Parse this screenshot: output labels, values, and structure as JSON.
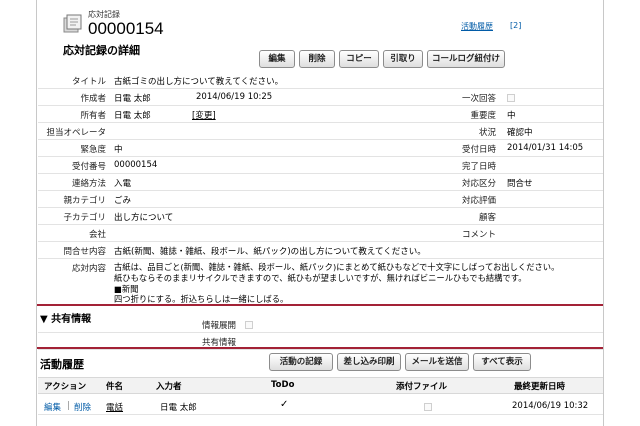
{
  "header": {
    "record_label": "応対記録",
    "record_number": "00000154",
    "detail_title": "応対記録の詳細",
    "history_link": "活動履歴",
    "history_count": "[2]"
  },
  "toolbar": {
    "edit": "編集",
    "delete": "削除",
    "copy": "コピー",
    "withdraw": "引取り",
    "link_call_log": "コールログ紐付け"
  },
  "fields": {
    "title_label": "タイトル",
    "title_value": "古紙ゴミの出し方について教えてください。",
    "creator_label": "作成者",
    "creator_value": "日電 太郎",
    "creator_date": "2014/06/19 10:25",
    "first_response_label": "一次回答",
    "owner_label": "所有者",
    "owner_value": "日電 太郎",
    "owner_change": "[変更]",
    "importance_label": "重要度",
    "importance_value": "中",
    "operator_label": "担当オペレータ",
    "status_label": "状況",
    "status_value": "確認中",
    "urgency_label": "緊急度",
    "urgency_value": "中",
    "received_label": "受付日時",
    "received_value": "2014/01/31 14:05",
    "receipt_no_label": "受付番号",
    "receipt_no_value": "00000154",
    "completed_label": "完了日時",
    "contact_method_label": "連絡方法",
    "contact_method_value": "入電",
    "response_type_label": "対応区分",
    "response_type_value": "問合せ",
    "parent_category_label": "親カテゴリ",
    "parent_category_value": "ごみ",
    "response_eval_label": "対応評価",
    "child_category_label": "子カテゴリ",
    "child_category_value": "出し方について",
    "customer_label": "顧客",
    "company_label": "会社",
    "comment_label": "コメント",
    "inquiry_label": "問合せ内容",
    "inquiry_value": "古紙(新聞、雑誌・雑紙、段ボール、紙パック)の出し方について教えてください。",
    "response_label": "応対内容",
    "response_lines": [
      "古紙は、品目ごと(新聞、雑誌・雑紙、段ボール、紙パック)にまとめて紙ひもなどで十文字にしばってお出しください。",
      "紙ひもならそのままリサイクルできますので、紙ひもが望ましいですが、無ければビニールひもでも結構です。",
      "■新聞",
      "四つ折りにする。折込ちらしは一緒にしばる。"
    ]
  },
  "shared": {
    "title": "▼ 共有情報",
    "info_expand_label": "情報展開",
    "shared_info_label": "共有情報"
  },
  "activity": {
    "title": "活動履歴",
    "buttons": {
      "record": "活動の記録",
      "mail_merge": "差し込み印刷",
      "send_mail": "メールを送信",
      "show_all": "すべて表示"
    },
    "columns": {
      "action": "アクション",
      "subject": "件名",
      "entered_by": "入力者",
      "todo": "ToDo",
      "attachment": "添付ファイル",
      "last_updated": "最終更新日時"
    },
    "row": {
      "edit": "編集",
      "divider": "|",
      "delete": "削除",
      "subject": "電話",
      "entered_by": "日電 太郎",
      "todo": "✓",
      "last_updated": "2014/06/19 10:32"
    }
  },
  "colors": {
    "accent": "#a32236",
    "link": "#015ba7"
  }
}
